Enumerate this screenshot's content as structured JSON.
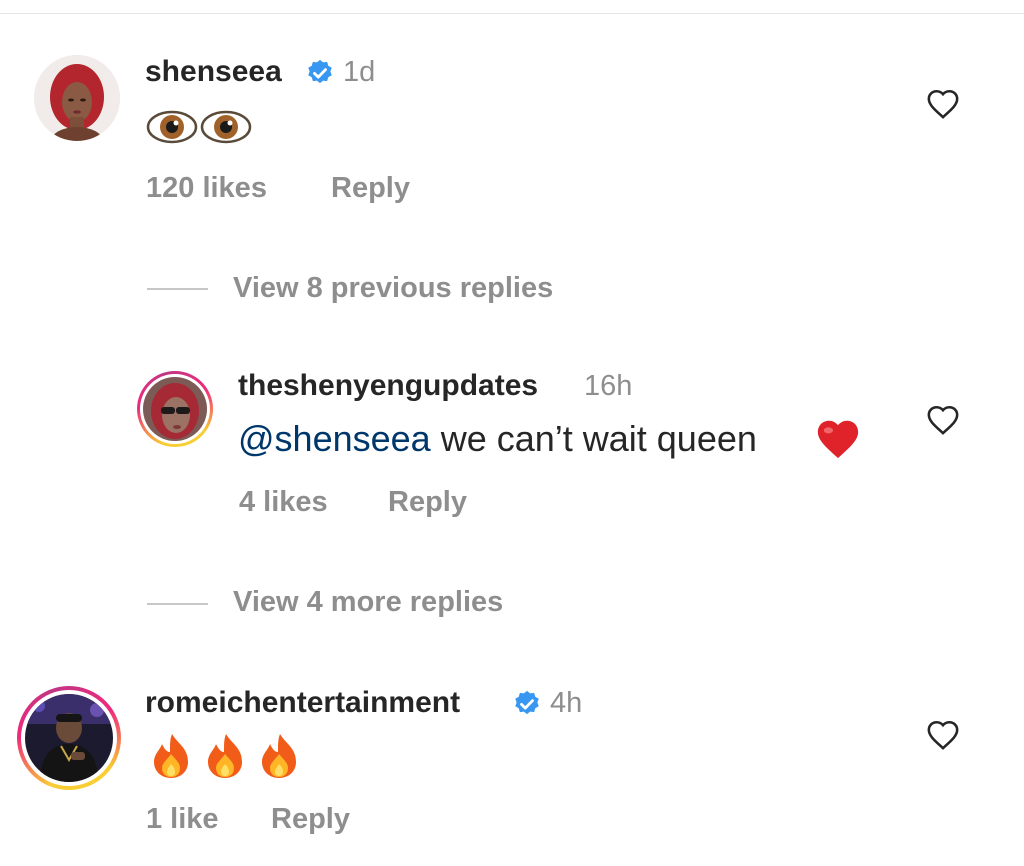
{
  "comments": [
    {
      "username": "shenseea",
      "verified": true,
      "time": "1d",
      "emoji_text": "👁👁",
      "likes": "120 likes",
      "reply": "Reply",
      "liked": false
    },
    {
      "username": "theshenyengupdates",
      "verified": false,
      "time": "16h",
      "mention": "@shenseea",
      "text": " we can’t wait queen ",
      "emoji_text": "❤️",
      "likes": "4 likes",
      "reply": "Reply",
      "liked": false
    },
    {
      "username": "romeichentertainment",
      "verified": true,
      "time": "4h",
      "emoji_text": "🔥🔥🔥",
      "likes": "1 like",
      "reply": "Reply",
      "liked": false
    }
  ],
  "thread_controls": {
    "view_previous": "View 8 previous replies",
    "view_more": "View 4 more replies"
  },
  "colors": {
    "verified_badge": "#3897f0",
    "mention": "#00376b",
    "muted_text": "#8e8e8e",
    "story_ring": [
      "#f9ce34",
      "#ee2a7b",
      "#c13584"
    ]
  },
  "icons": [
    "verified-badge-icon",
    "heart-outline-icon",
    "eye-emoji",
    "red-heart-emoji",
    "fire-emoji"
  ]
}
